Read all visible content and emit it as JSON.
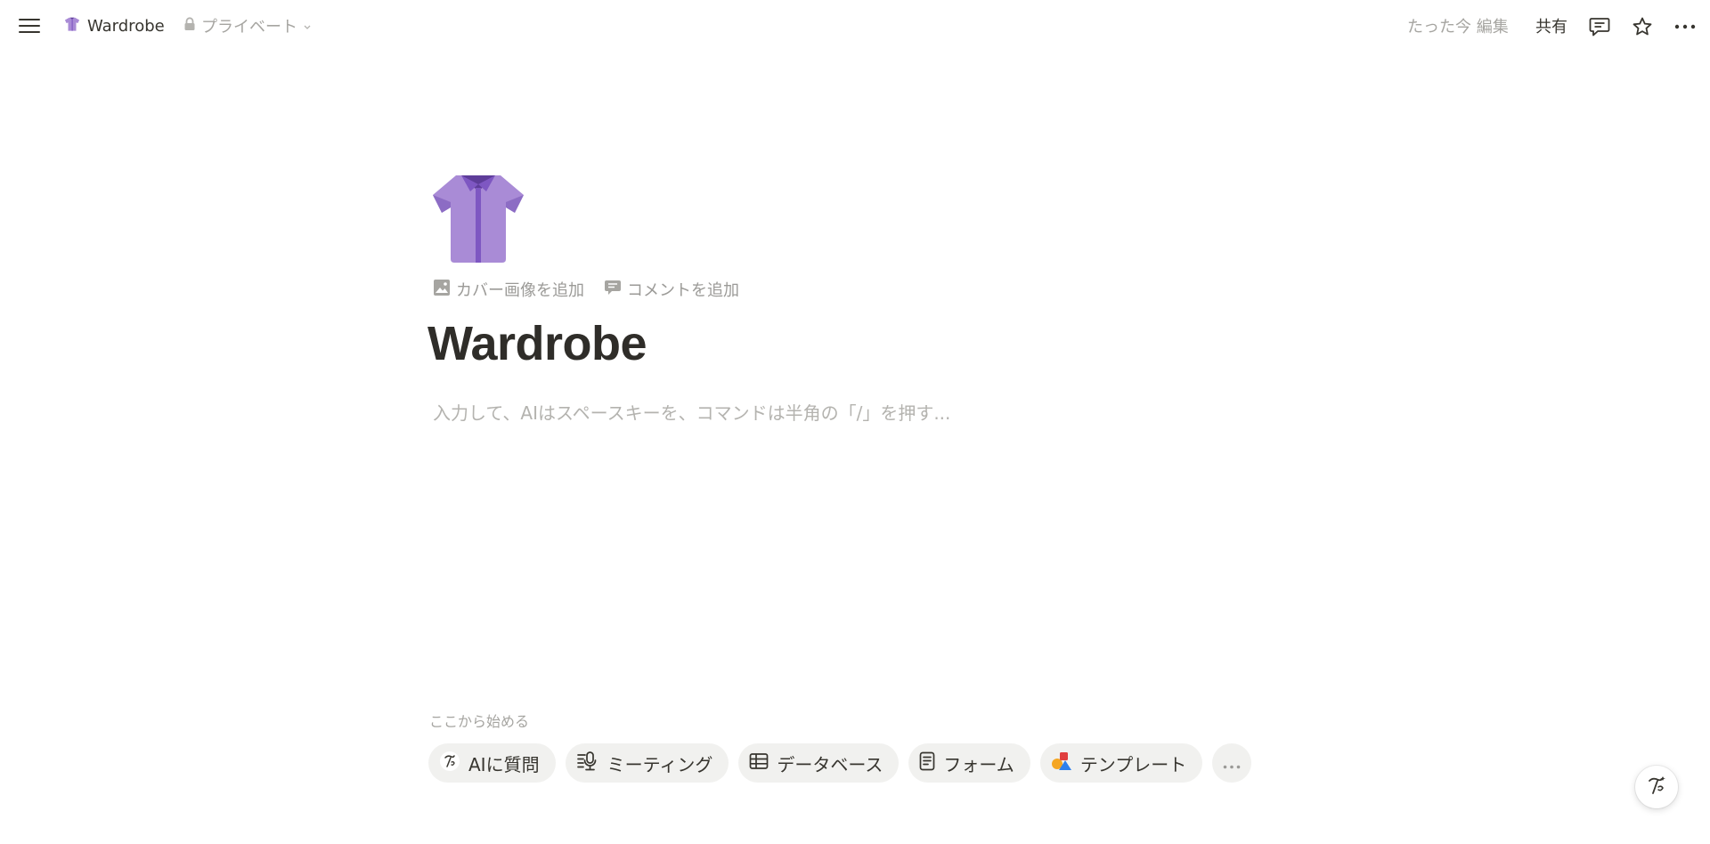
{
  "topbar": {
    "page_title": "Wardrobe",
    "privacy_label": "プライベート",
    "edited_label": "たった今 編集",
    "share_label": "共有"
  },
  "icons": {
    "menu": "hamburger-icon",
    "page_emoji": "shirt-icon",
    "lock": "lock-icon",
    "chevron": "chevron-down-icon",
    "comments": "comment-icon",
    "favorite": "star-icon",
    "more": "more-horizontal-icon",
    "ai": "notion-ai-icon"
  },
  "page": {
    "add_cover_label": "カバー画像を追加",
    "add_comment_label": "コメントを追加",
    "title": "Wardrobe",
    "placeholder": "入力して、AIはスペースキーを、コマンドは半角の「/」を押す..."
  },
  "start": {
    "label": "ここから始める",
    "chips": [
      {
        "label": "AIに質問",
        "icon": "notion-ai-icon"
      },
      {
        "label": "ミーティング",
        "icon": "microphone-icon"
      },
      {
        "label": "データベース",
        "icon": "table-icon"
      },
      {
        "label": "フォーム",
        "icon": "form-icon"
      },
      {
        "label": "テンプレート",
        "icon": "template-icon"
      }
    ],
    "more_icon": "more-horizontal-icon"
  },
  "colors": {
    "text": "#37352f",
    "muted": "#a6a5a1",
    "chip_bg": "#f1f1ef",
    "shirt": "#a98bd6",
    "shirt_dark": "#7e57c2"
  }
}
